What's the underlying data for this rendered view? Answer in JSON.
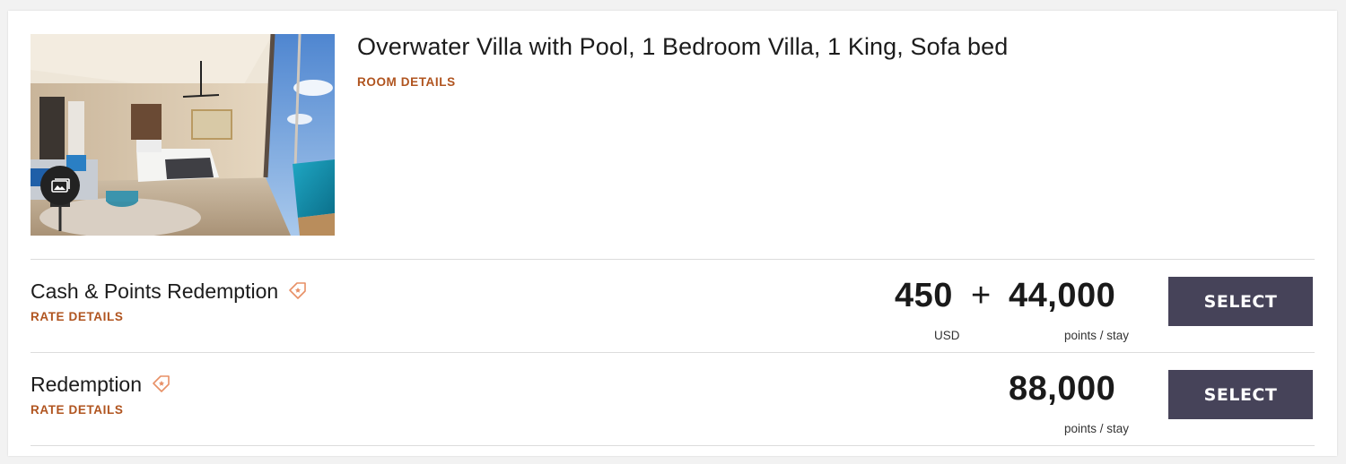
{
  "room": {
    "title": "Overwater Villa with Pool, 1 Bedroom Villa, 1 King, Sofa bed",
    "details_link": "ROOM DETAILS",
    "image_icon": "room-photo",
    "gallery_icon": "photo-gallery-icon"
  },
  "rates": [
    {
      "name": "Cash & Points Redemption",
      "details_link": "RATE DETAILS",
      "icon": "tag-icon",
      "cash_amount": "450",
      "plus": "+",
      "cash_unit": "USD",
      "points_amount": "44,000",
      "points_unit": "points / stay",
      "button_label": "SELECT"
    },
    {
      "name": "Redemption",
      "details_link": "RATE DETAILS",
      "icon": "tag-icon",
      "points_amount": "88,000",
      "points_unit": "points / stay",
      "button_label": "SELECT"
    }
  ],
  "colors": {
    "accent": "#b0541f",
    "button": "#464359",
    "divider": "#dcdcdc"
  }
}
